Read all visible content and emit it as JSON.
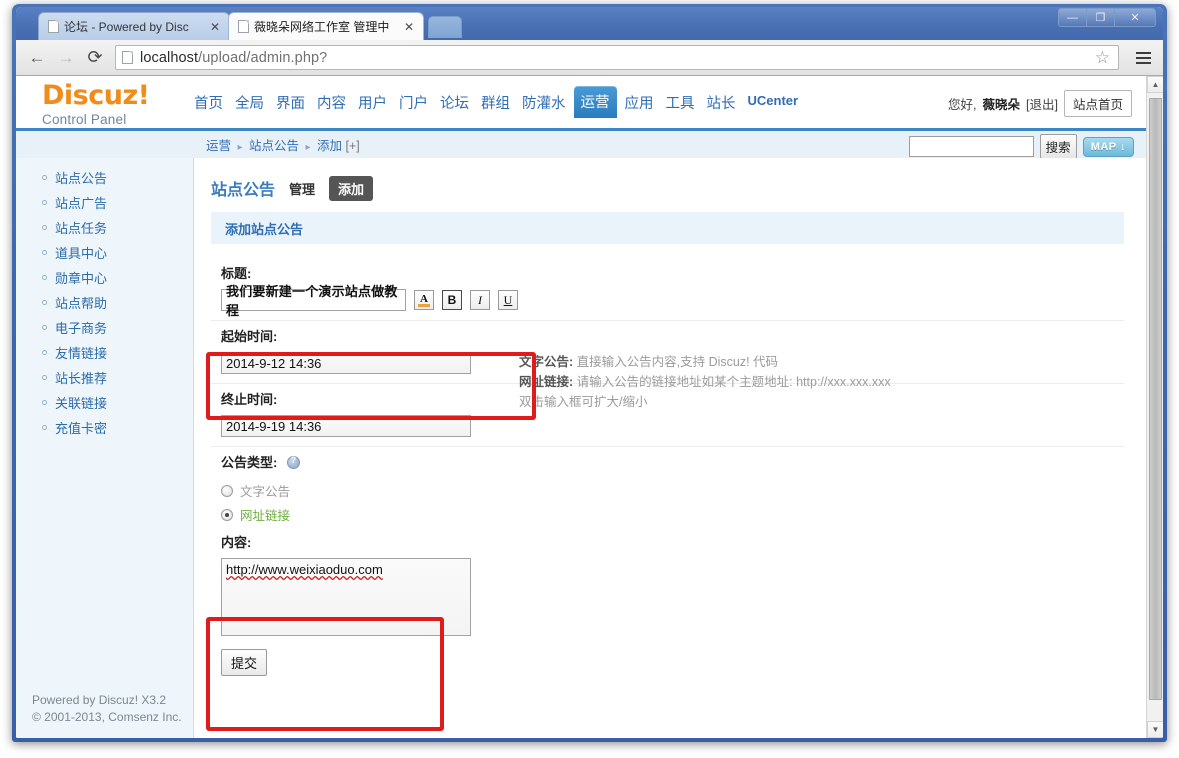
{
  "browser": {
    "tabs": [
      {
        "title": "论坛 - Powered by Disc",
        "active": false
      },
      {
        "title": "薇晓朵网络工作室 管理中",
        "active": true
      }
    ],
    "close_glyph": "✕",
    "back_glyph": "←",
    "forward_glyph": "→",
    "reload_glyph": "⟳",
    "star_glyph": "☆",
    "url_host": "localhost",
    "url_path": "/upload/admin.php?",
    "window_controls": {
      "minimize": "—",
      "maximize": "❐",
      "close": "✕"
    }
  },
  "header": {
    "logo_main": "Discuz!",
    "logo_sub": "Control Panel",
    "nav": [
      {
        "label": "首页",
        "current": false
      },
      {
        "label": "全局",
        "current": false
      },
      {
        "label": "界面",
        "current": false
      },
      {
        "label": "内容",
        "current": false
      },
      {
        "label": "用户",
        "current": false
      },
      {
        "label": "门户",
        "current": false
      },
      {
        "label": "论坛",
        "current": false
      },
      {
        "label": "群组",
        "current": false
      },
      {
        "label": "防灌水",
        "current": false
      },
      {
        "label": "运营",
        "current": true
      },
      {
        "label": "应用",
        "current": false
      },
      {
        "label": "工具",
        "current": false
      },
      {
        "label": "站长",
        "current": false
      },
      {
        "label": "UCenter",
        "current": false
      }
    ],
    "greeting": "您好,",
    "username": "薇晓朵",
    "logout": "[退出]",
    "site_home_button": "站点首页"
  },
  "subbar": {
    "breadcrumb": [
      "运营",
      "站点公告",
      "添加"
    ],
    "breadcrumb_plus": "[+]",
    "separator": "▸",
    "search_value": "",
    "search_placeholder": "",
    "search_button": "搜索",
    "map_button": "MAP ↓"
  },
  "sidebar": {
    "items": [
      {
        "label": "站点公告"
      },
      {
        "label": "站点广告"
      },
      {
        "label": "站点任务"
      },
      {
        "label": "道具中心"
      },
      {
        "label": "勋章中心"
      },
      {
        "label": "站点帮助"
      },
      {
        "label": "电子商务"
      },
      {
        "label": "友情链接"
      },
      {
        "label": "站长推荐"
      },
      {
        "label": "关联链接"
      },
      {
        "label": "充值卡密"
      }
    ],
    "footer_line1": "Powered by Discuz! X3.2",
    "footer_line2": "© 2001-2013, Comsenz Inc."
  },
  "content": {
    "title": "站点公告",
    "tabs": [
      {
        "label": "管理",
        "current": false
      },
      {
        "label": "添加",
        "current": true
      }
    ],
    "banner": "添加站点公告",
    "form": {
      "title_label": "标题:",
      "title_value": "我们要新建一个演示站点做教程",
      "format_buttons": [
        {
          "name": "color",
          "glyph": "A"
        },
        {
          "name": "bold",
          "glyph": "B"
        },
        {
          "name": "italic",
          "glyph": "I"
        },
        {
          "name": "underline",
          "glyph": "U"
        }
      ],
      "start_label": "起始时间:",
      "start_value": "2014-9-12 14:36",
      "end_label": "终止时间:",
      "end_value": "2014-9-19 14:36",
      "type_label": "公告类型:",
      "type_options": [
        {
          "label": "文字公告",
          "checked": false
        },
        {
          "label": "网址链接",
          "checked": true
        }
      ],
      "content_label": "内容:",
      "content_value": "http://www.weixiaoduo.com",
      "submit_label": "提交"
    },
    "hints": [
      {
        "bold": "文字公告:",
        "text": "直接输入公告内容,支持 Discuz! 代码"
      },
      {
        "bold": "网址链接:",
        "text": "请输入公告的链接地址如某个主题地址: http://xxx.xxx.xxx"
      },
      {
        "bold": "",
        "text": "双击输入框可扩大/缩小"
      }
    ]
  },
  "annotations": {
    "box_color": "#e01b1b",
    "boxes": [
      {
        "name": "title-field-highlight"
      },
      {
        "name": "url-content-highlight"
      }
    ]
  },
  "scrollbar": {
    "up_glyph": "▲",
    "down_glyph": "▼"
  }
}
